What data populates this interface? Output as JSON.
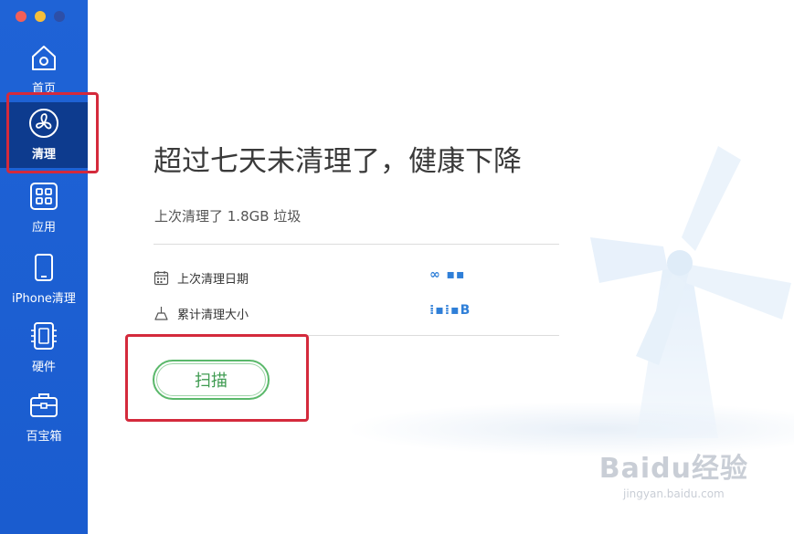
{
  "sidebar": {
    "items": [
      {
        "label": "首页",
        "icon": "home-icon"
      },
      {
        "label": "清理",
        "icon": "fan-icon"
      },
      {
        "label": "应用",
        "icon": "apps-grid-icon"
      },
      {
        "label": "iPhone清理",
        "icon": "phone-icon"
      },
      {
        "label": "硬件",
        "icon": "chip-icon"
      },
      {
        "label": "百宝箱",
        "icon": "toolbox-icon"
      }
    ],
    "active_index": 1
  },
  "main": {
    "title": "超过七天未清理了，健康下降",
    "subtitle": "上次清理了 1.8GB 垃圾",
    "info": [
      {
        "label": "上次清理日期",
        "icon": "calendar-icon",
        "value": "∞ ▪▪"
      },
      {
        "label": "累计清理大小",
        "icon": "broom-icon",
        "value": "⁞▪⁞▪B"
      }
    ],
    "scan_label": "扫描"
  },
  "watermark": {
    "logo": "Baidu经验",
    "url": "jingyan.baidu.com"
  },
  "colors": {
    "sidebar": "#1f63d6",
    "active": "#0d3b8e",
    "highlight": "#d42a3c",
    "scan_green": "#3f9b51"
  }
}
